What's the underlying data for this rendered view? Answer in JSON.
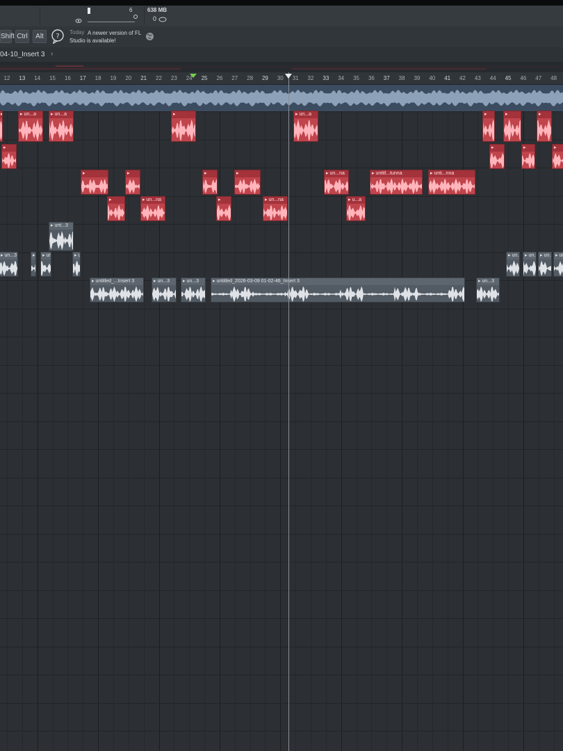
{
  "toolbar": {
    "tempo_digit": "6",
    "memory": "638 MB",
    "cpu_value": "0"
  },
  "modifier_keys": {
    "shift": "Shift",
    "ctrl": "Ctrl",
    "alt": "Alt"
  },
  "hint": {
    "date": "Today",
    "message": "A newer version of FL Studio is available!"
  },
  "playlist": {
    "pattern_name": "04-10_Insert 3",
    "pattern_arrow": "›"
  },
  "ruler": {
    "bars": [
      "12",
      "13",
      "14",
      "15",
      "16",
      "17",
      "18",
      "19",
      "20",
      "21",
      "22",
      "23",
      "24",
      "25",
      "26",
      "27",
      "28",
      "29",
      "30",
      "31",
      "32",
      "33",
      "34",
      "35",
      "36",
      "37",
      "38",
      "39",
      "40",
      "41",
      "42",
      "43",
      "44",
      "45",
      "46",
      "47",
      "48"
    ]
  },
  "clips": {
    "red": [
      {
        "label": "▸▸",
        "name": "audio-clip"
      },
      {
        "label": "▸  un...a",
        "name": "audio-clip"
      },
      {
        "label": "▸",
        "name": "audio-clip"
      },
      {
        "label": "▸  un...a",
        "name": "audio-clip"
      },
      {
        "label": "▸",
        "name": "audio-clip"
      },
      {
        "label": "▸",
        "name": "audio-clip"
      },
      {
        "label": "▸",
        "name": "audio-clip"
      },
      {
        "label": "▸  un...na",
        "name": "audio-clip"
      },
      {
        "label": "▸  untitl...tunna",
        "name": "audio-clip"
      },
      {
        "label": "▸  unti...nna",
        "name": "audio-clip"
      },
      {
        "label": "▸  un...na",
        "name": "audio-clip"
      },
      {
        "label": "▸  un...na",
        "name": "audio-clip"
      },
      {
        "label": "▸  u...a",
        "name": "audio-clip"
      }
    ],
    "gray": [
      {
        "label": "▸  unt...3",
        "name": "audio-clip"
      },
      {
        "label": "▸  untitled_...Insert 3",
        "name": "audio-clip"
      },
      {
        "label": "▸  un...3",
        "name": "audio-clip"
      },
      {
        "label": "▸  un...3",
        "name": "audio-clip"
      },
      {
        "label": "▸  untitled_2026-03-09 01-02-46_Insert 3",
        "name": "audio-clip"
      },
      {
        "label": "▸  un...3",
        "name": "audio-clip"
      }
    ]
  },
  "colors": {
    "clip_red": "#c0444c",
    "clip_gray": "#525a63",
    "loop_marker": "#7bd14a",
    "master_wave": "#8da2b8"
  }
}
